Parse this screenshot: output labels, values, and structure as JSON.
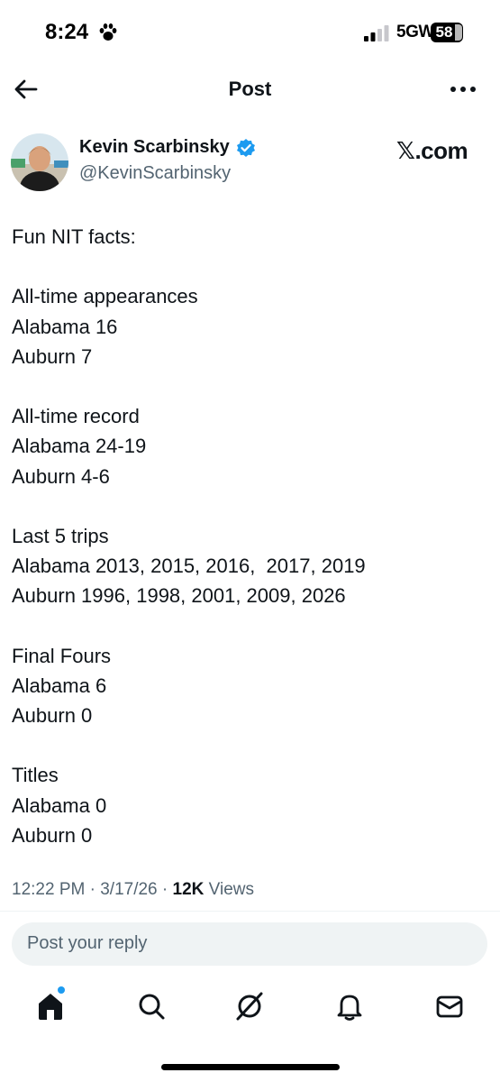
{
  "status_bar": {
    "time": "8:24",
    "network": "5GW",
    "battery": "58"
  },
  "header": {
    "title": "Post",
    "back_icon": "arrow-left-icon",
    "more_icon": "more-horizontal-icon"
  },
  "author": {
    "name": "Kevin Scarbinsky",
    "handle": "@KevinScarbinsky",
    "verified": true,
    "source": "𝕏.com"
  },
  "post": {
    "lines": [
      "Fun NIT facts:",
      "",
      "All-time appearances",
      "Alabama 16",
      "Auburn 7",
      "",
      "All-time record",
      "Alabama 24-19",
      "Auburn 4-6",
      "",
      "Last 5 trips",
      "Alabama 2013, 2015, 2016,  2017, 2019",
      "Auburn 1996, 1998, 2001, 2009, 2026",
      "",
      "Final Fours",
      "Alabama 6",
      "Auburn 0",
      "",
      "Titles",
      "Alabama 0",
      "Auburn 0"
    ]
  },
  "meta": {
    "time": "12:22 PM",
    "separator": "·",
    "date": "3/17/26",
    "views_count": "12K",
    "views_label": "Views"
  },
  "reply": {
    "placeholder": "Post your reply"
  },
  "nav": {
    "items": [
      "home-icon",
      "search-icon",
      "grok-icon",
      "bell-icon",
      "mail-icon"
    ]
  },
  "colors": {
    "accent": "#1d9bf0",
    "text": "#0f1419",
    "secondary_text": "#536471",
    "reply_bg": "#eff3f4"
  }
}
